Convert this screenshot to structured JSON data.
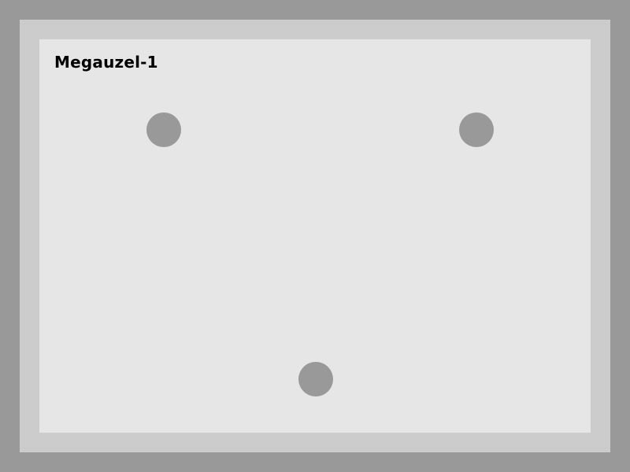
{
  "panel": {
    "title": "Megauzel-1"
  },
  "colors": {
    "background": "#999999",
    "frame": "#cccccc",
    "panel": "#e6e6e6",
    "dot": "#999999",
    "text": "#000000"
  },
  "dots": [
    {
      "name": "dot-top-left"
    },
    {
      "name": "dot-top-right"
    },
    {
      "name": "dot-bottom-center"
    }
  ]
}
